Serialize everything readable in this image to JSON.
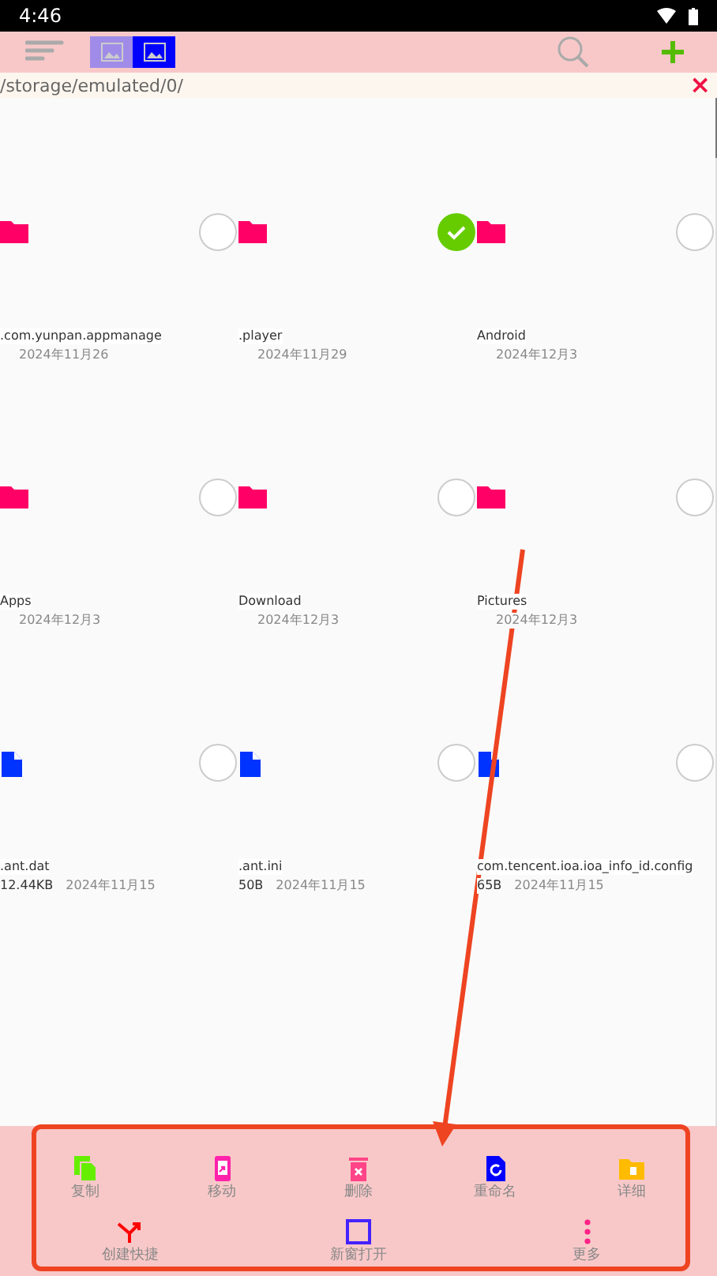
{
  "status_bar": {
    "time": "4:46"
  },
  "toolbar": {
    "view_modes": [
      {
        "selected": false
      },
      {
        "selected": true
      }
    ]
  },
  "path_bar": {
    "path": "/storage/emulated/0/",
    "close": "×"
  },
  "files": [
    {
      "kind": "folder",
      "name": ".com.yunpan.appmanage",
      "date": "2024年11月26",
      "selected": false
    },
    {
      "kind": "folder",
      "name": ".player",
      "date": "2024年11月29",
      "selected": true
    },
    {
      "kind": "folder",
      "name": "Android",
      "date": "2024年12月3",
      "selected": false
    },
    {
      "kind": "folder",
      "name": "Apps",
      "date": "2024年12月3",
      "selected": false
    },
    {
      "kind": "folder",
      "name": "Download",
      "date": "2024年12月3",
      "selected": false
    },
    {
      "kind": "folder",
      "name": "Pictures",
      "date": "2024年12月3",
      "selected": false
    },
    {
      "kind": "file",
      "name": ".ant.dat",
      "size": "12.44KB",
      "date": "2024年11月15",
      "selected": false
    },
    {
      "kind": "file",
      "name": ".ant.ini",
      "size": "50B",
      "date": "2024年11月15",
      "selected": false
    },
    {
      "kind": "file",
      "name": "com.tencent.ioa.ioa_info_id.config",
      "size": "65B",
      "date": "2024年11月15",
      "selected": false
    }
  ],
  "actions": [
    [
      {
        "kind": "copy",
        "label": "复制",
        "color": "#66ee00"
      },
      {
        "kind": "move",
        "label": "移动",
        "color": "#ff22aa"
      },
      {
        "kind": "delete",
        "label": "删除",
        "color": "#ff4488"
      },
      {
        "kind": "rename",
        "label": "重命名",
        "color": "#0000ff"
      },
      {
        "kind": "details",
        "label": "详细",
        "color": "#ffbb00"
      }
    ],
    [
      {
        "kind": "shortcut",
        "label": "创建快捷",
        "color": "#ff0000"
      },
      {
        "kind": "new_window",
        "label": "新窗打开",
        "color": "#4422ff"
      },
      {
        "kind": "more",
        "label": "更多",
        "color": "#ff2288"
      }
    ]
  ]
}
